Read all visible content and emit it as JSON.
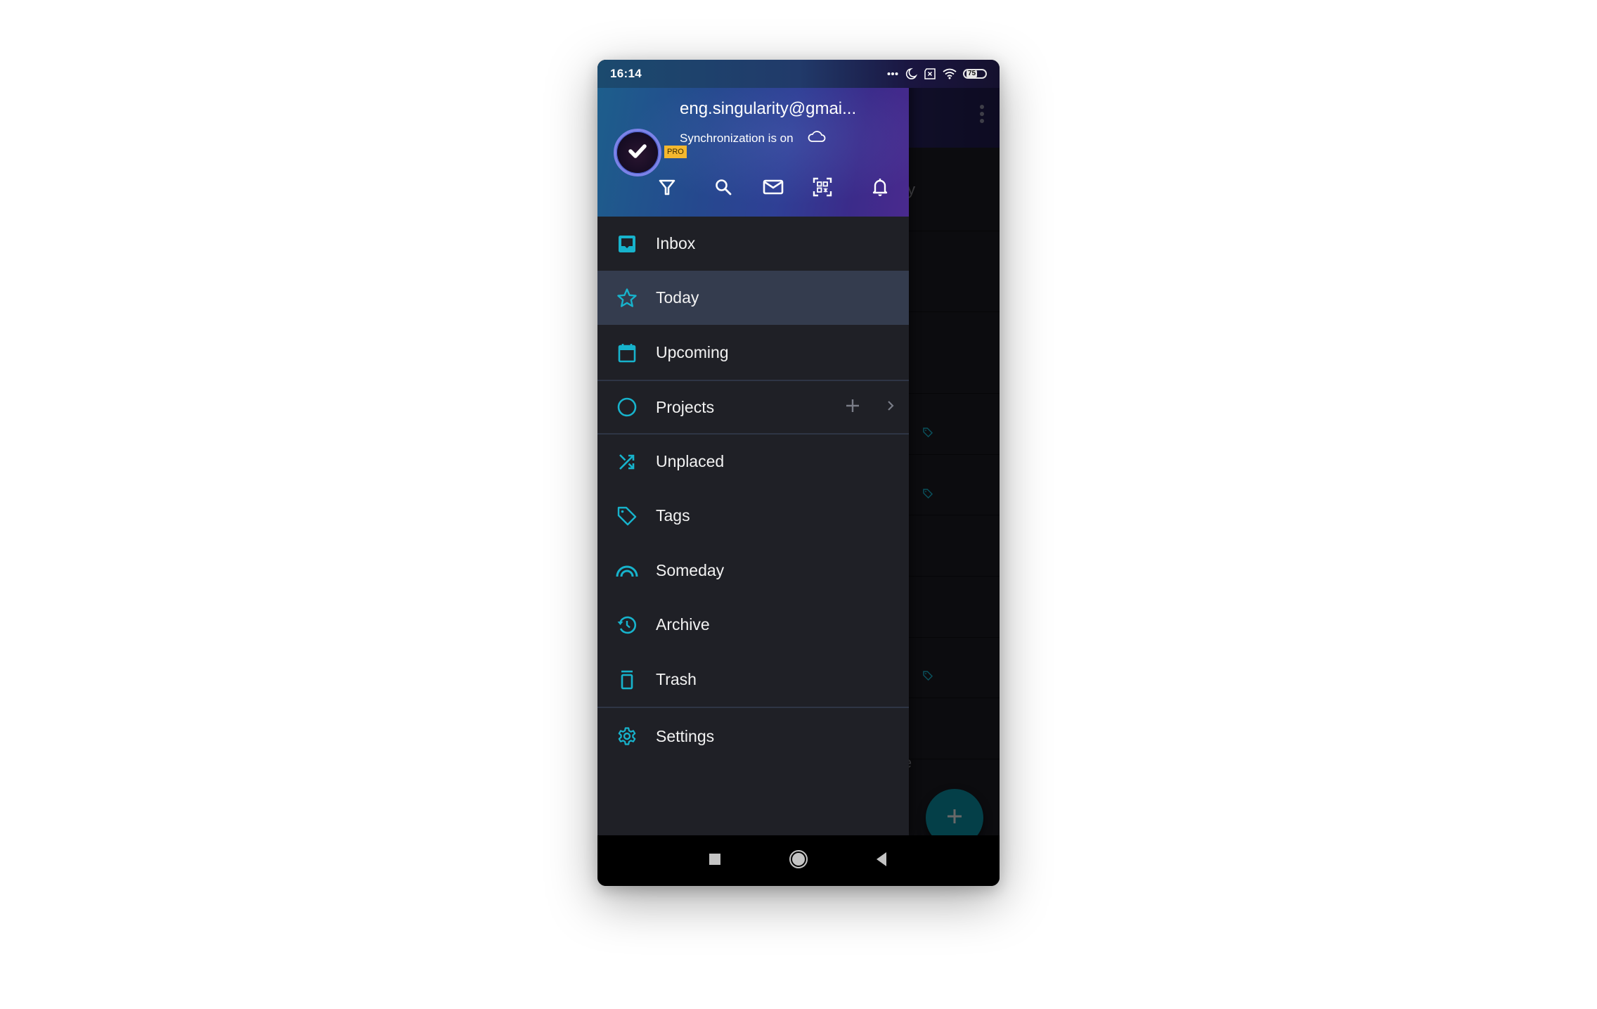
{
  "status_bar": {
    "time": "16:14",
    "icons": [
      "more-dots-icon",
      "do-not-disturb-moon-icon",
      "no-sim-icon",
      "wifi-icon",
      "battery-icon"
    ],
    "battery_level": "75"
  },
  "drawer": {
    "header": {
      "badge": "PRO",
      "account_email": "eng.singularity@gmai...",
      "sync_status": "Synchronization is on",
      "sync_icon": "cloud-icon",
      "actions": [
        {
          "name": "filter",
          "icon": "filter-icon"
        },
        {
          "name": "search",
          "icon": "search-icon"
        },
        {
          "name": "mail",
          "icon": "mail-icon"
        },
        {
          "name": "qr-scan",
          "icon": "qr-code-scan-icon"
        },
        {
          "name": "notifications",
          "icon": "bell-icon"
        }
      ]
    },
    "menu": [
      {
        "id": "inbox",
        "label": "Inbox",
        "icon": "inbox-icon",
        "active": false
      },
      {
        "id": "today",
        "label": "Today",
        "icon": "star-icon",
        "active": true
      },
      {
        "id": "upcoming",
        "label": "Upcoming",
        "icon": "calendar-icon",
        "active": false
      },
      {
        "id": "projects",
        "label": "Projects",
        "icon": "circle-icon",
        "active": false,
        "actions": [
          "add-icon",
          "chevron-right-icon"
        ]
      },
      {
        "id": "unplaced",
        "label": "Unplaced",
        "icon": "shuffle-icon",
        "active": false
      },
      {
        "id": "tags",
        "label": "Tags",
        "icon": "tag-icon",
        "active": false
      },
      {
        "id": "someday",
        "label": "Someday",
        "icon": "rainbow-icon",
        "active": false
      },
      {
        "id": "archive",
        "label": "Archive",
        "icon": "history-icon",
        "active": false
      },
      {
        "id": "trash",
        "label": "Trash",
        "icon": "trash-icon",
        "active": false
      },
      {
        "id": "settings",
        "label": "Settings",
        "icon": "gear-icon",
        "active": false
      }
    ]
  },
  "background": {
    "partial_text_top": "cy",
    "partial_text_bottom": "ie",
    "fab_icon": "plus-icon"
  },
  "nav_bar": {
    "buttons": [
      "recents-square-icon",
      "home-circle-icon",
      "back-triangle-icon"
    ]
  },
  "colors": {
    "accent": "#17b3cc",
    "drawer_bg": "#1f2026",
    "active_row": "#343c4e",
    "fab": "#0a8da0",
    "pro_badge": "#f5b82e"
  }
}
